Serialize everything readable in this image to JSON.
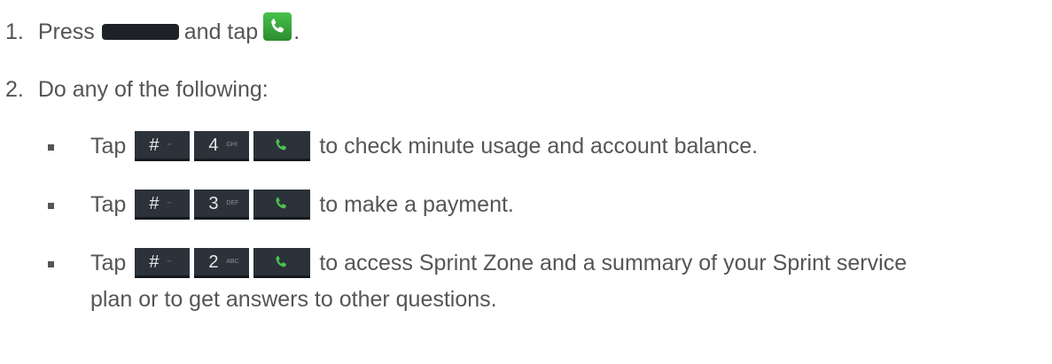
{
  "step1": {
    "number": "1.",
    "text_before": "Press",
    "text_middle": "and tap",
    "text_end": "."
  },
  "step2": {
    "number": "2.",
    "text": "Do any of the following:"
  },
  "bullets": [
    {
      "prefix": "Tap",
      "keys": [
        {
          "main": "#",
          "sub": "◦◦"
        },
        {
          "main": "4",
          "sub": "GHI"
        }
      ],
      "text": "to check minute usage and account balance."
    },
    {
      "prefix": "Tap",
      "keys": [
        {
          "main": "#",
          "sub": "◦◦"
        },
        {
          "main": "3",
          "sub": "DEF"
        }
      ],
      "text": "to make a payment."
    },
    {
      "prefix": "Tap",
      "keys": [
        {
          "main": "#",
          "sub": "◦◦"
        },
        {
          "main": "2",
          "sub": "ABC"
        }
      ],
      "text": "to access Sprint Zone and a summary of your Sprint service",
      "text_line2": "plan or to get answers to other questions."
    }
  ],
  "icons": {
    "home_key": "home-key-icon",
    "phone_app": "phone-app-icon",
    "call_key": "phone-handset-icon"
  },
  "colors": {
    "text": "#555555",
    "key_bg": "#2b323a",
    "phone_green": "#3fb043"
  }
}
